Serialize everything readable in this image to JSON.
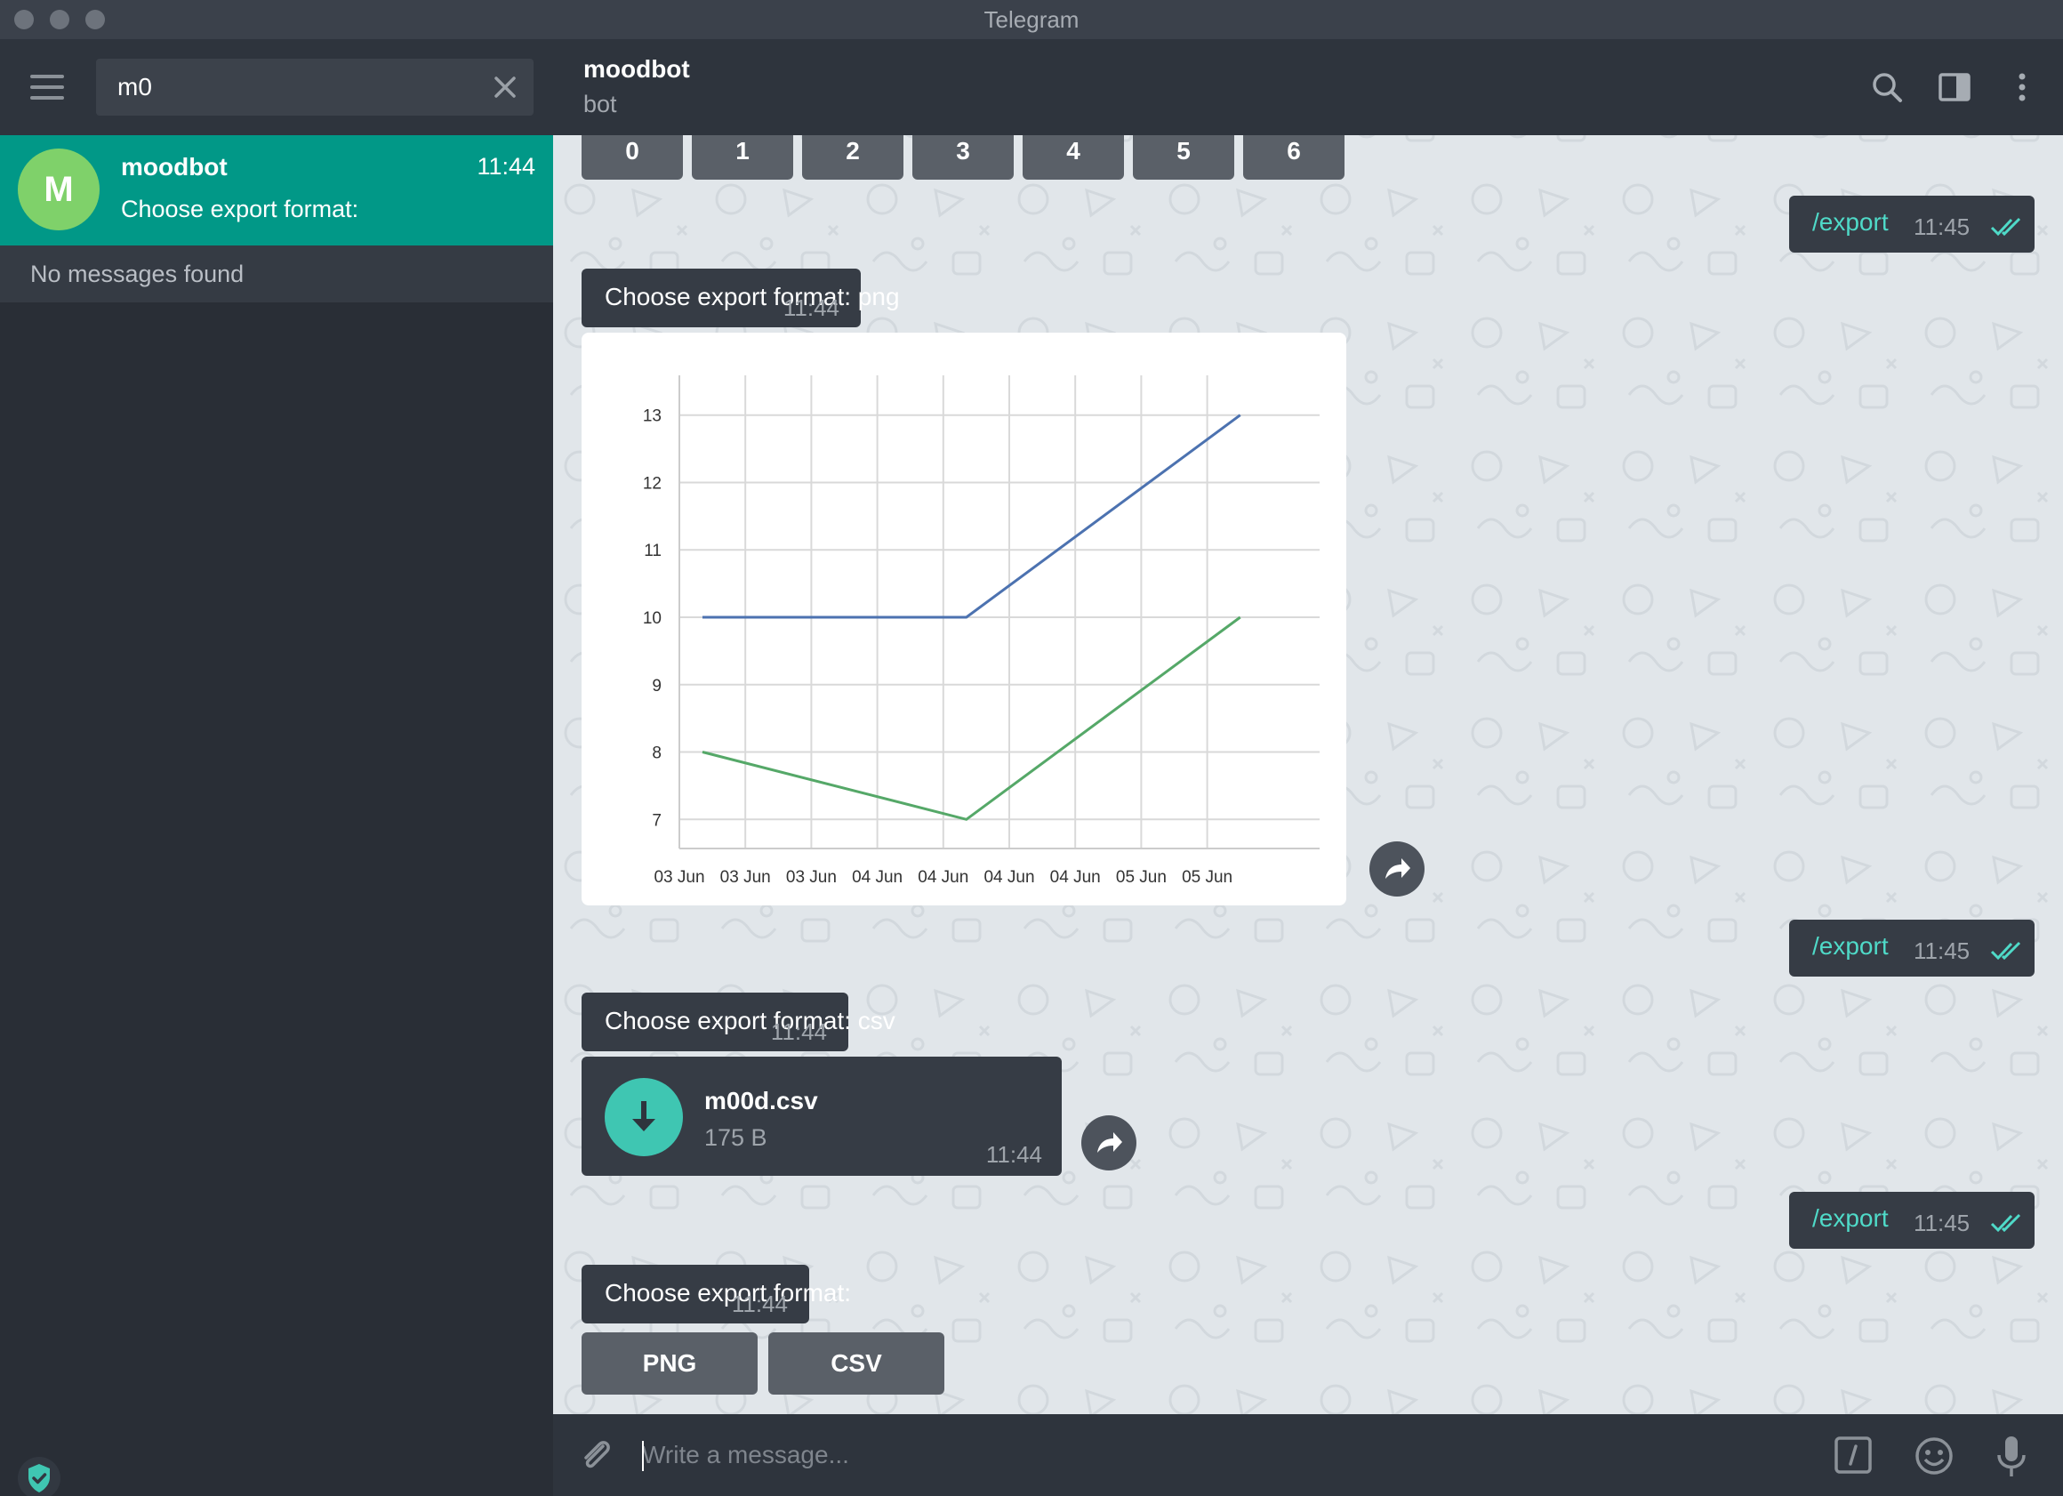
{
  "window": {
    "title": "Telegram"
  },
  "sidebar": {
    "search_value": "m0",
    "chats": [
      {
        "avatar_letter": "M",
        "name": "moodbot",
        "time": "11:44",
        "preview": "Choose export format:"
      }
    ],
    "no_messages": "No messages found"
  },
  "header": {
    "name": "moodbot",
    "status": "bot"
  },
  "keyboard_top": [
    "0",
    "1",
    "2",
    "3",
    "4",
    "5",
    "6"
  ],
  "messages": {
    "out1": {
      "text": "/export",
      "time": "11:45"
    },
    "in1": {
      "text": "Choose export format: png",
      "time": "11:44"
    },
    "out2": {
      "text": "/export",
      "time": "11:45"
    },
    "in2": {
      "text": "Choose export format: csv",
      "time": "11:44"
    },
    "file": {
      "name": "m00d.csv",
      "size": "175 B",
      "time": "11:44"
    },
    "out3": {
      "text": "/export",
      "time": "11:45"
    },
    "in3": {
      "text": "Choose export format:",
      "time": "11:44"
    }
  },
  "keyboard_bottom": [
    "PNG",
    "CSV"
  ],
  "composer": {
    "placeholder": "Write a message..."
  },
  "colors": {
    "accent": "#019887",
    "link": "#4fdac8",
    "series1": "#4c72b0",
    "series2": "#55a868"
  },
  "chart_data": {
    "type": "line",
    "x": [
      "03 Jun",
      "03 Jun",
      "03 Jun",
      "04 Jun",
      "04 Jun",
      "04 Jun",
      "04 Jun",
      "05 Jun",
      "05 Jun"
    ],
    "series": [
      {
        "points": [
          [
            0.35,
            10
          ],
          [
            4.35,
            10
          ],
          [
            8.5,
            13
          ]
        ],
        "color": "#4c72b0"
      },
      {
        "points": [
          [
            0.35,
            8
          ],
          [
            4.35,
            7
          ],
          [
            8.5,
            10
          ]
        ],
        "color": "#55a868"
      }
    ],
    "y_ticks": [
      7,
      8,
      9,
      10,
      11,
      12,
      13
    ],
    "ylim": [
      6.7,
      13.3
    ],
    "grid": true
  }
}
